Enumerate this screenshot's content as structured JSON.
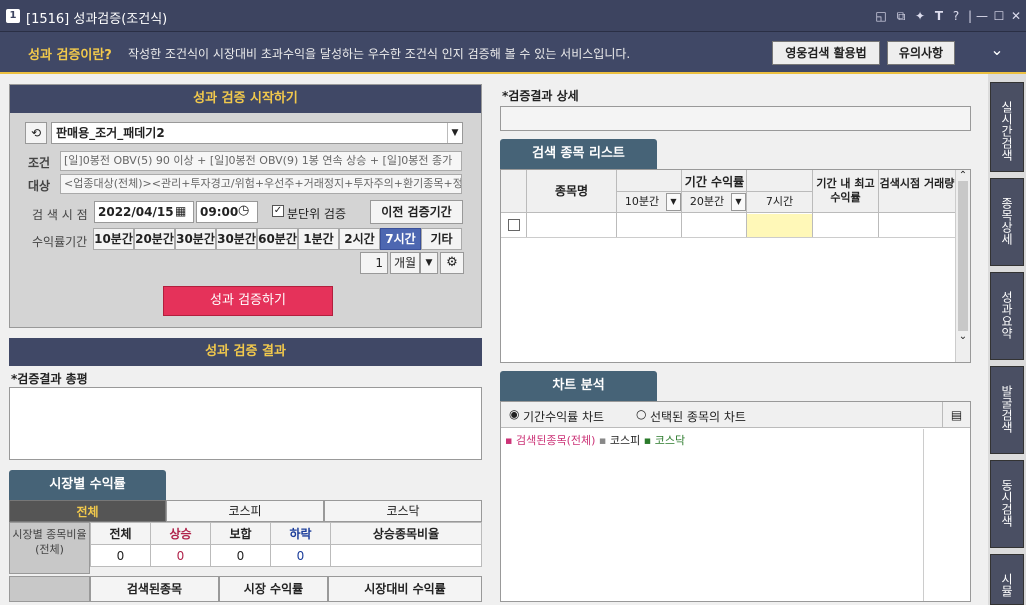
{
  "window": {
    "icon": "1",
    "title": "[1516] 성과검증(조건식)"
  },
  "info": {
    "question": "성과 검증이란?",
    "desc": "작성한 조건식이 시장대비 초과수익을 달성하는 우수한 조건식 인지 검증해 볼 수 있는 서비스입니다.",
    "btn1": "영웅검색 활용법",
    "btn2": "유의사항"
  },
  "start": {
    "header": "성과 검증 시작하기",
    "condition_name": "판매용_조거_패데기2",
    "cond_label": "조건",
    "cond_text": "[일]0봉전 OBV(5) 90 이상 + [일]0봉전 OBV(9) 1봉 연속 상승 + [일]0봉전 종가",
    "target_label": "대상",
    "target_text": "<업종대상(전체)><관리+투자경고/위험+우선주+거래정지+투자주의+환기종목+정",
    "time_label": "검 색 시 점",
    "date": "2022/04/15",
    "time": "09:00",
    "minute_check": "분단위 검증",
    "prev_btn": "이전 검증기간",
    "period_label": "수익률기간",
    "periods": [
      "10분간",
      "20분간",
      "30분간",
      "30분간",
      "60분간",
      "1분간",
      "2시간",
      "7시간",
      "기타"
    ],
    "month_value": "1",
    "month_unit": "개월",
    "verify_btn": "성과 검증하기"
  },
  "result": {
    "header": "성과 검증 결과",
    "summary_label": "*검증결과 총평"
  },
  "market": {
    "tab": "시장별 수익률",
    "subtabs": [
      "전체",
      "코스피",
      "코스닥"
    ],
    "row_label": "시장별 종목비율 (전체)",
    "cols": [
      "전체",
      "상승",
      "보합",
      "하락",
      "상승종목비율"
    ],
    "vals": [
      "0",
      "0",
      "0",
      "0",
      ""
    ],
    "footer": [
      "검색된종목",
      "시장 수익률",
      "시장대비 수익률"
    ]
  },
  "detail": {
    "label": "*검증결과 상세"
  },
  "stocklist": {
    "tab": "검색 종목 리스트",
    "col_name": "종목명",
    "col_period": "기간 수익률",
    "sub1": "10분간",
    "sub2": "20분간",
    "sub3": "7시간",
    "col_max": "기간 내 최고수익률",
    "col_vol": "검색시점 거래량"
  },
  "chart": {
    "tab": "차트 분석",
    "radio1": "기간수익률 차트",
    "radio2": "선택된 종목의 차트",
    "legend": [
      {
        "label": "검색된종목(전체)",
        "color": "#cc3377"
      },
      {
        "label": "코스피",
        "color": "#222222"
      },
      {
        "label": "코스닥",
        "color": "#2a7a2a"
      }
    ]
  },
  "side": [
    "실시간검색",
    "종목상세",
    "성과요약",
    "발굴검색",
    "동시검색",
    "시뮬"
  ]
}
